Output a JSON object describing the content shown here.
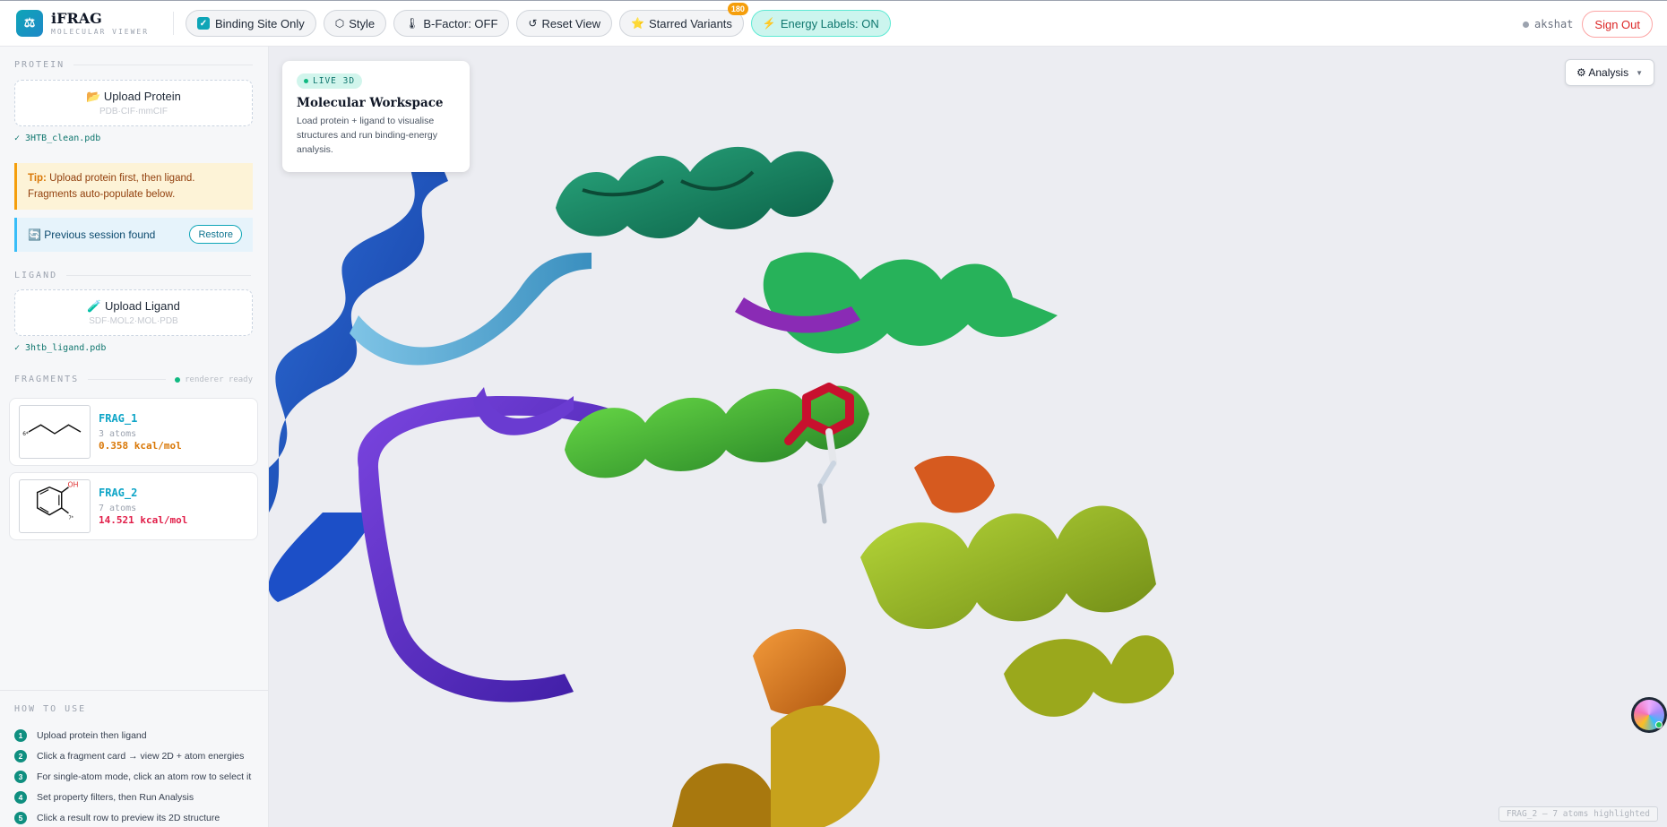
{
  "header": {
    "app_name": "iFRAG",
    "app_subtitle": "MOLECULAR VIEWER",
    "logo_glyph": "⚖",
    "toolbar": {
      "binding_site": {
        "label": "Binding Site Only",
        "checked": true
      },
      "style": {
        "icon": "⬡",
        "label": "Style"
      },
      "bfactor": {
        "icon": "🌡",
        "label": "B-Factor: OFF"
      },
      "reset": {
        "icon": "↺",
        "label": "Reset View"
      },
      "starred": {
        "icon": "⭐",
        "label": "Starred Variants",
        "badge": "180"
      },
      "energy": {
        "icon": "⚡",
        "label": "Energy Labels: ON"
      }
    },
    "user": "akshat",
    "sign_out": "Sign Out"
  },
  "sidebar": {
    "protein": {
      "section": "PROTEIN",
      "upload_title": "📂 Upload Protein",
      "upload_formats": "PDB·CIF·mmCIF",
      "file": "✓ 3HTB_clean.pdb"
    },
    "tip": {
      "prefix": "Tip:",
      "text": " Upload protein first, then ligand. Fragments auto-populate below."
    },
    "session": {
      "text": "🔄 Previous session found",
      "restore": "Restore"
    },
    "ligand": {
      "section": "LIGAND",
      "upload_title": "🧪 Upload Ligand",
      "upload_formats": "SDF·MOL2·MOL·PDB",
      "file": "✓ 3htb_ligand.pdb"
    },
    "fragments": {
      "section": "FRAGMENTS",
      "status": "renderer ready",
      "items": [
        {
          "name": "FRAG_1",
          "atoms": "3 atoms",
          "energy": "0.358 kcal/mol",
          "energy_color": "#d97706",
          "star_label": "6*"
        },
        {
          "name": "FRAG_2",
          "atoms": "7 atoms",
          "energy": "14.521 kcal/mol",
          "energy_color": "#e11d48",
          "oh_label": "OH",
          "star_label": "7*"
        }
      ]
    },
    "howto": {
      "section": "HOW TO USE",
      "steps": [
        {
          "num": "1",
          "text": "Upload protein then ligand"
        },
        {
          "num": "2",
          "text": "Click a fragment card → view 2D + atom energies"
        },
        {
          "num": "3",
          "text": "For single-atom mode, click an atom row to select it"
        },
        {
          "num": "4",
          "text": "Set property filters, then Run Analysis"
        },
        {
          "num": "5",
          "text": "Click a result row to preview its 2D structure"
        }
      ]
    }
  },
  "viewer": {
    "live_badge": "LIVE 3D",
    "title": "Molecular Workspace",
    "description": "Load protein + ligand to visualise structures and run binding-energy analysis.",
    "analysis_button": "⚙ Analysis",
    "analysis_caret": "▼",
    "status": "FRAG_2 — 7 atoms highlighted"
  }
}
